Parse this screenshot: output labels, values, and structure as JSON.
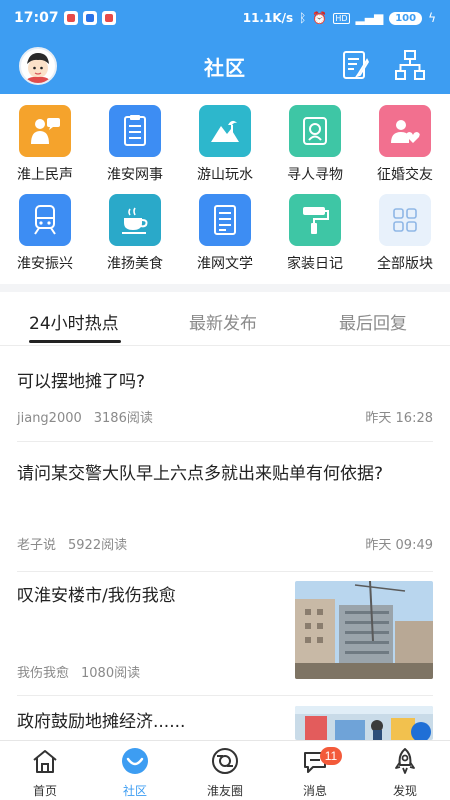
{
  "status_bar": {
    "time": "17:07",
    "net_speed": "11.1K/s",
    "battery": "100"
  },
  "header": {
    "title": "社区"
  },
  "colors": {
    "brand": "#3d9df2",
    "active_tab_text": "#222222",
    "badge": "#f35a3a"
  },
  "categories": [
    {
      "label": "淮上民声",
      "icon": "megaphone-person-icon",
      "color": "#f5a32c"
    },
    {
      "label": "淮安网事",
      "icon": "checklist-icon",
      "color": "#3d8df3"
    },
    {
      "label": "游山玩水",
      "icon": "landscape-icon",
      "color": "#2db7cc"
    },
    {
      "label": "寻人寻物",
      "icon": "search-person-icon",
      "color": "#3ec6a5"
    },
    {
      "label": "征婚交友",
      "icon": "heart-person-icon",
      "color": "#f2708f"
    },
    {
      "label": "淮安振兴",
      "icon": "train-icon",
      "color": "#3d8df3"
    },
    {
      "label": "淮扬美食",
      "icon": "teacup-icon",
      "color": "#2aa9c9"
    },
    {
      "label": "淮网文学",
      "icon": "document-icon",
      "color": "#3d8df3"
    },
    {
      "label": "家装日记",
      "icon": "paint-roller-icon",
      "color": "#3ec6a5"
    },
    {
      "label": "全部版块",
      "icon": "grid-icon",
      "color": "#e8f1fb"
    }
  ],
  "tabs": [
    {
      "label": "24小时热点"
    },
    {
      "label": "最新发布"
    },
    {
      "label": "最后回复"
    }
  ],
  "posts": [
    {
      "title": "可以摆地摊了吗?",
      "author": "jiang2000",
      "reads": "3186阅读",
      "time": "昨天 16:28"
    },
    {
      "title": "请问某交警大队早上六点多就出来贴单有何依据?",
      "author": "老子说",
      "reads": "5922阅读",
      "time": "昨天 09:49"
    },
    {
      "title": "叹淮安楼市/我伤我愈",
      "author": "我伤我愈",
      "reads": "1080阅读",
      "time": ""
    },
    {
      "title": "政府鼓励地摊经济......",
      "author": "",
      "reads": "",
      "time": ""
    }
  ],
  "bottom_nav": [
    {
      "label": "首页",
      "icon": "home-icon"
    },
    {
      "label": "社区",
      "icon": "community-icon"
    },
    {
      "label": "淮友圈",
      "icon": "camera-circle-icon"
    },
    {
      "label": "消息",
      "icon": "message-icon",
      "badge": "11"
    },
    {
      "label": "发现",
      "icon": "rocket-icon"
    }
  ]
}
